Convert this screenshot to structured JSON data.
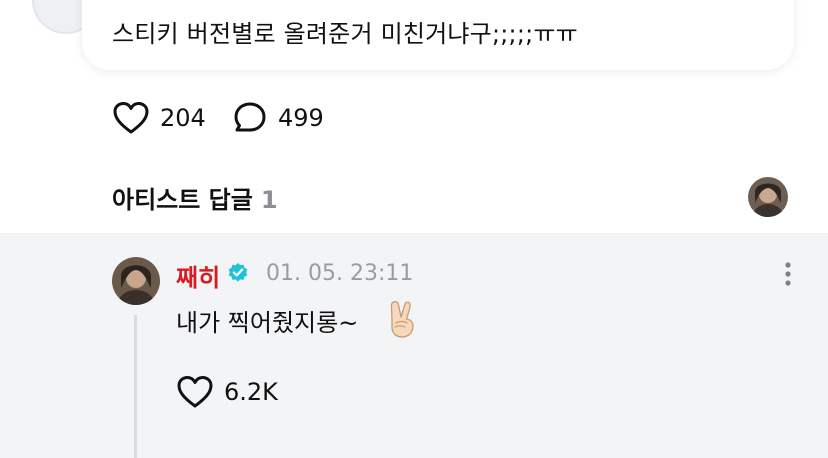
{
  "post": {
    "text": "스티키 버전별로 올려준거 미친거냐구;;;;;ㅠㅠ",
    "likes": "204",
    "comments": "499"
  },
  "artist_replies": {
    "title": "아티스트 답글",
    "count": "1"
  },
  "reply": {
    "author": "째히",
    "date": "01. 05. 23:11",
    "text": "내가 찍어줬지롱~",
    "likes": "6.2K"
  },
  "colors": {
    "author_name": "#d81b22",
    "verified_badge": "#1fc3d6",
    "reply_background": "#f3f4f6",
    "muted_text": "#9a9ca3"
  },
  "icons": {
    "like": "heart-outline-icon",
    "comment": "speech-bubble-icon",
    "verified": "verified-badge-icon",
    "more": "vertical-dots-icon",
    "emoji": "victory-hand-emoji"
  }
}
